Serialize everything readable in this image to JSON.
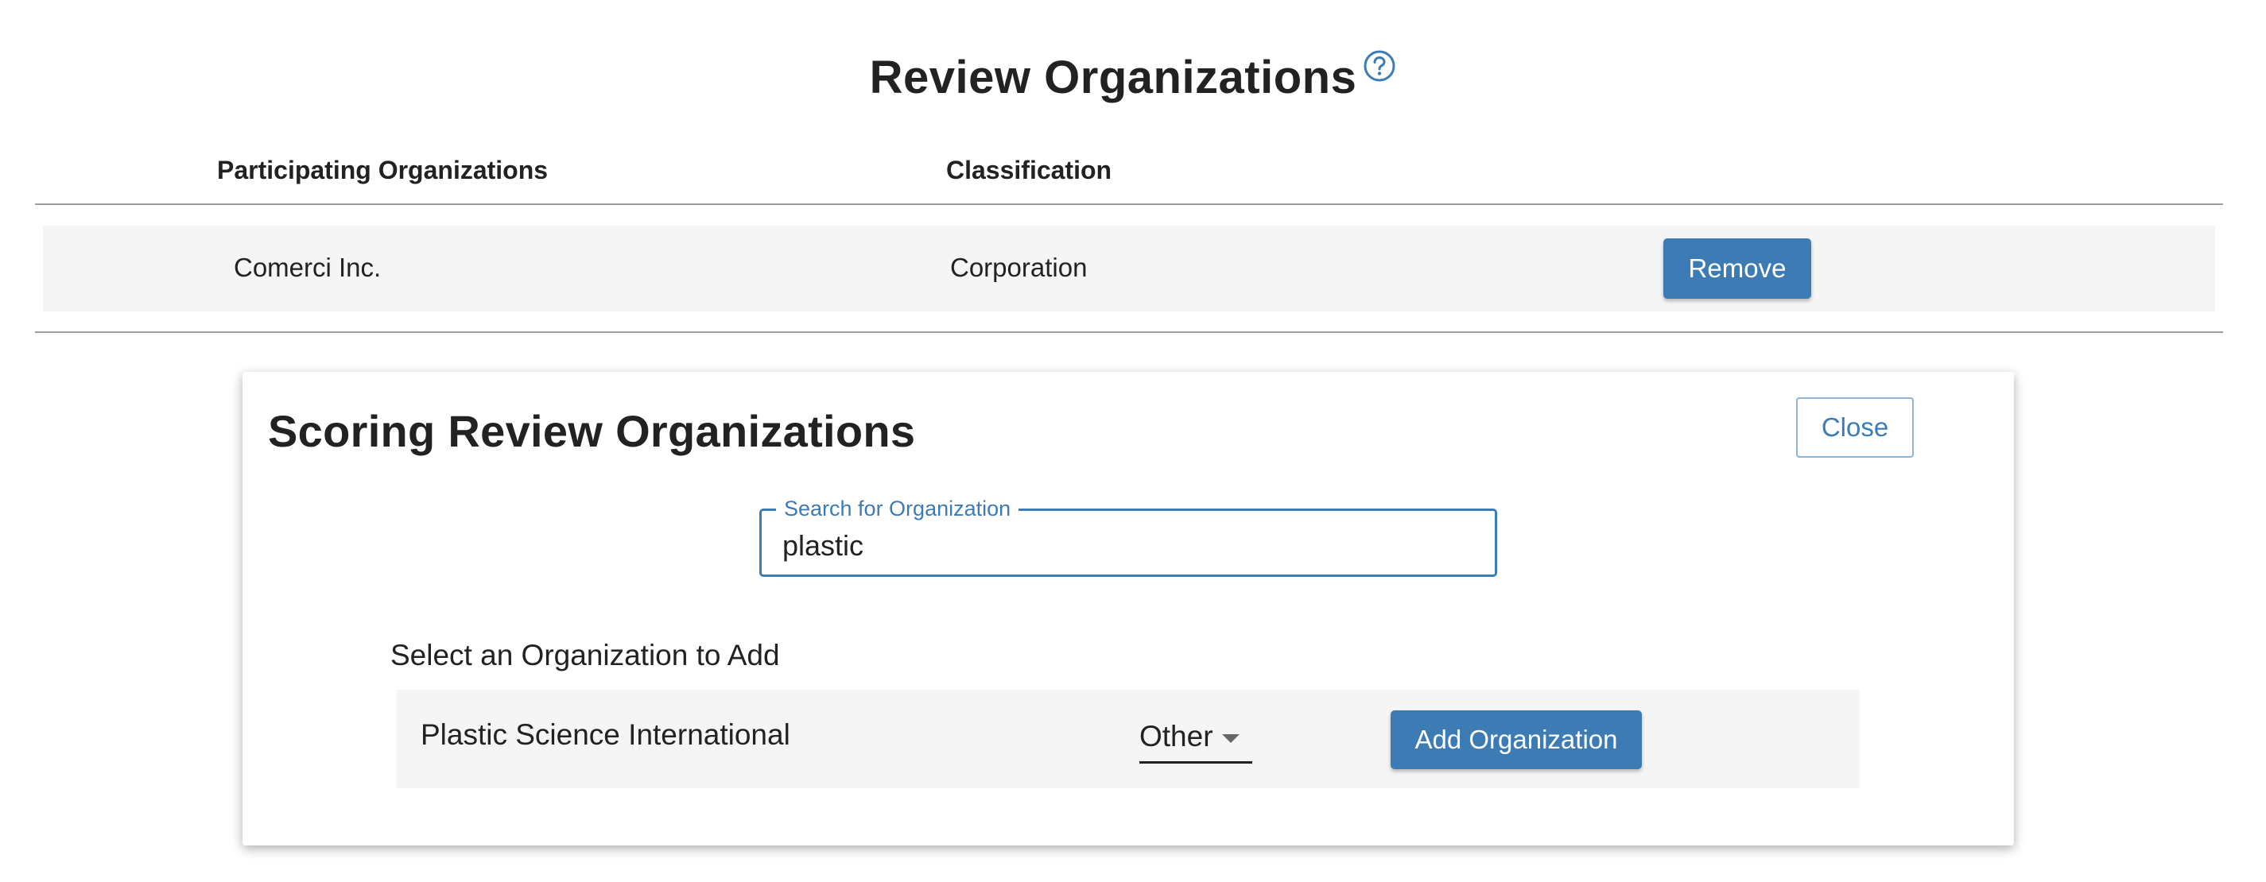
{
  "header": {
    "title": "Review Organizations",
    "help_icon": "question-circle-icon"
  },
  "table": {
    "columns": [
      "Participating Organizations",
      "Classification"
    ],
    "rows": [
      {
        "organization": "Comerci Inc.",
        "classification": "Corporation",
        "action_label": "Remove"
      }
    ]
  },
  "panel": {
    "title": "Scoring Review Organizations",
    "close_label": "Close",
    "search": {
      "label": "Search for Organization",
      "value": "plastic"
    },
    "results_label": "Select an Organization to Add",
    "results": [
      {
        "organization": "Plastic Science International",
        "classification": "Other",
        "action_label": "Add Organization"
      }
    ]
  },
  "colors": {
    "accent": "#3c7bb4",
    "row_background": "#f5f5f5",
    "divider": "#9e9e9e",
    "text": "#222222"
  }
}
